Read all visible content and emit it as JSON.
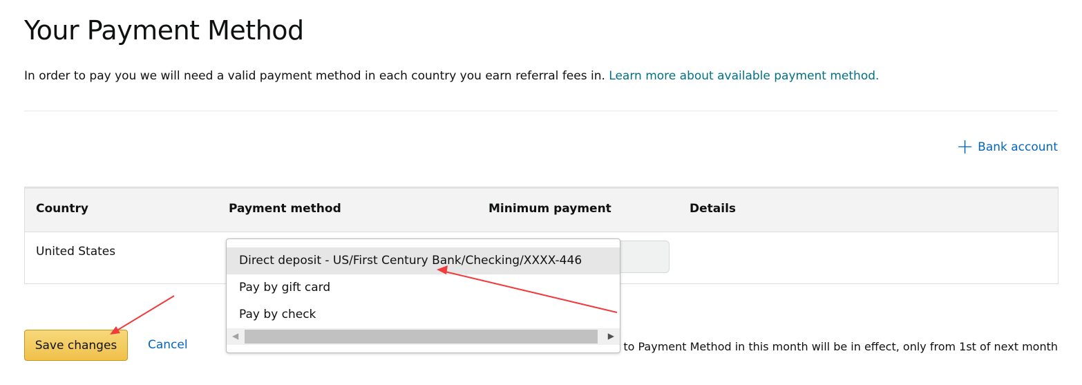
{
  "page": {
    "title": "Your Payment Method",
    "intro": "In order to pay you we will need a valid payment method in each country you earn referral fees in.",
    "intro_link": "Learn more about available payment method."
  },
  "add_bank": {
    "label": "Bank account",
    "icon": "plus-icon"
  },
  "table": {
    "headers": [
      "Country",
      "Payment method",
      "Minimum payment",
      "Details"
    ],
    "rows": [
      {
        "country": "United States"
      }
    ]
  },
  "dropdown": {
    "options": [
      "Direct deposit - US/First Century Bank/Checking/XXXX-446",
      "Pay by gift card",
      "Pay by check"
    ],
    "selected": 0
  },
  "actions": {
    "save": "Save changes",
    "cancel": "Cancel"
  },
  "note": "Any updates to Payment Method in this month will be in effect, only from 1st of next month",
  "colors": {
    "link": "#007185",
    "action_link": "#0066c0",
    "save_button": "#f0c14b",
    "annotation_arrow": "#f03c3c"
  }
}
